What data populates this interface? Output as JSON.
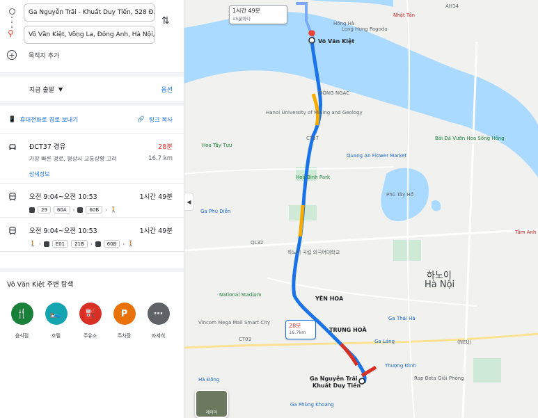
{
  "origin": {
    "value": "Ga Nguyễn Trãi - Khuất Duy Tiến, 528 Đ. N"
  },
  "destination": {
    "value": "Võ Văn Kiệt, Võng La, Đông Anh, Hà Nội, V"
  },
  "add_destination": "목적지 추가",
  "depart": {
    "label": "지금 출발",
    "options": "옵션"
  },
  "share": {
    "send_phone": "휴대전화로 경로 보내기",
    "copy_link": "링크 복사"
  },
  "routes": {
    "car": {
      "title": "ĐCT37 경유",
      "time": "28분",
      "subtitle": "가장 빠른 경로, 평상시 교통상황 고려",
      "distance": "16.7 km",
      "details": "상세정보"
    },
    "bus1": {
      "title": "오전 9:04~오전 10:53",
      "time": "1시간 49분",
      "chips": [
        "29",
        "60A",
        "60B"
      ]
    },
    "bus2": {
      "title": "오전 9:04~오전 10:53",
      "time": "1시간 49분",
      "chips": [
        "E01",
        "21B",
        "60B"
      ]
    }
  },
  "explore": {
    "title": "Võ Văn Kiệt 주변 탐색",
    "categories": [
      {
        "label": "음식점",
        "icon": "restaurant-icon",
        "color": "#188038"
      },
      {
        "label": "호텔",
        "icon": "hotel-icon",
        "color": "#12a4af"
      },
      {
        "label": "주유소",
        "icon": "gas-station-icon",
        "color": "#d93025"
      },
      {
        "label": "주차장",
        "icon": "parking-icon",
        "color": "#e8710a"
      },
      {
        "label": "자세히",
        "icon": "more-icon",
        "color": "#5f6368"
      }
    ]
  },
  "map": {
    "callout_top": {
      "time": "1시간 49분",
      "sub": "15분마다"
    },
    "callout_car": {
      "time": "28분",
      "distance": "16.7km"
    },
    "dest_label": "Võ Văn Kiệt",
    "origin_label_1": "Ga Nguyễn Trãi -",
    "origin_label_2": "Khuất Duy Tiến",
    "labels": {
      "hanoi_kr": "하노이",
      "hanoi_vn": "Hà Nội",
      "nhat_tan": "Nhật Tân",
      "hong_ha": "Hồng Hà",
      "dong_ngac": "ĐÔNG NGẠC",
      "hoa_binh": "Hoà Bình Park",
      "hoa_tay": "Hoa Tây Tựu",
      "phu_tay_ho": "Phủ Tây Hồ",
      "yen_hoa": "YÊN HOA",
      "trung_hoa": "TRUNG HOÀ",
      "long_hung": "Long Hưng Pagoda",
      "quang_an": "Quang An Flower Market",
      "mining": "Hanoi University of Mining and Geology",
      "ga_lang": "Ga Láng",
      "ga_thai_ha": "Ga Thái Hà",
      "ga_phu_dien": "Ga Phú Diễn",
      "thuong_dinh": "Thượng Đình",
      "rap_beta": "Rap Beta Giải Phóng",
      "tam_anh": "Tâm Anh Hospital",
      "national_stadium": "National Stadium",
      "ct37": "CT37",
      "ct03": "CT03",
      "ql32": "QL32",
      "ah14": "AH14",
      "vincom": "Vincom Mega Mall Smart City",
      "neu": "(NEU)",
      "phung_khoang": "Ga Phùng Khoang",
      "hoa_dong": "Hà Đông",
      "bai_da": "Bãi Đá Vườn Hoa Sông Hồng",
      "dai_hoc": "하노이 국립 외국어대학교",
      "layer": "레이어"
    }
  }
}
